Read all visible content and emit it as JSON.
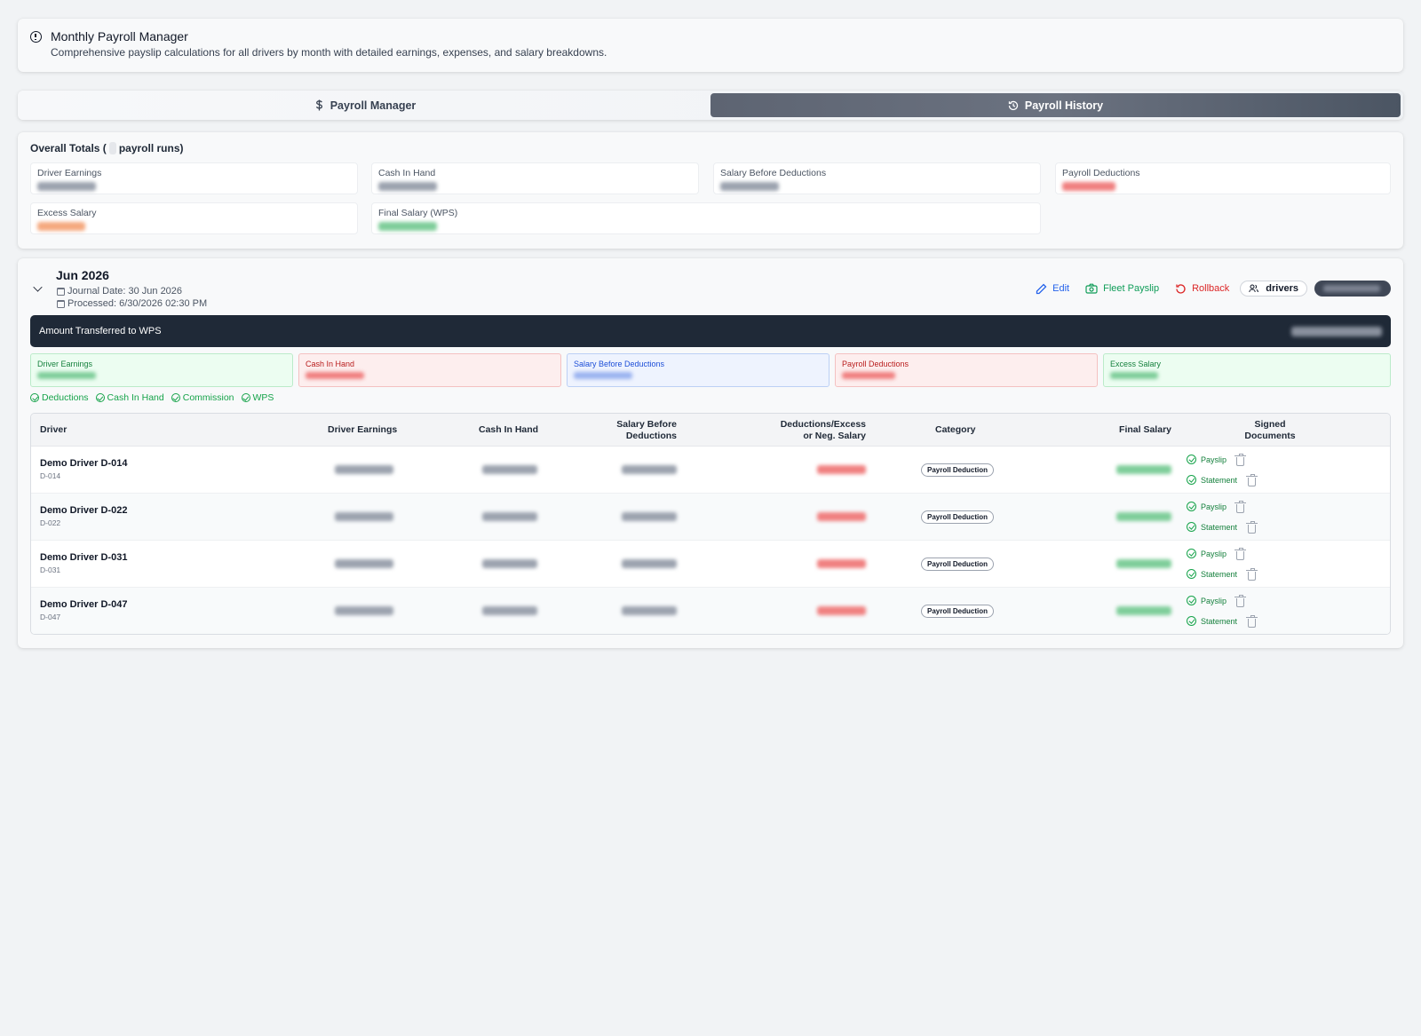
{
  "header": {
    "title": "Monthly Payroll Manager",
    "description": "Comprehensive payslip calculations for all drivers by month with detailed earnings, expenses, and salary breakdowns."
  },
  "tabs": [
    {
      "label": "Payroll Manager",
      "icon": "dollar-icon",
      "active": false
    },
    {
      "label": "Payroll History",
      "icon": "history-icon",
      "active": true
    }
  ],
  "overall": {
    "heading_prefix": "Overall Totals (",
    "heading_suffix": "payroll runs)",
    "stats": [
      {
        "label": "Driver Earnings"
      },
      {
        "label": "Cash In Hand"
      },
      {
        "label": "Salary Before Deductions"
      },
      {
        "label": "Payroll Deductions"
      },
      {
        "label": "Excess Salary"
      },
      {
        "label": "Final Salary (WPS)"
      }
    ]
  },
  "run": {
    "month": "Jun 2026",
    "journal_date": "Journal Date: 30 Jun 2026",
    "processed": "Processed: 6/30/2026 02:30 PM",
    "actions": {
      "edit": "Edit",
      "fleet_payslip": "Fleet Payslip",
      "rollback": "Rollback",
      "drivers": "drivers"
    },
    "wps_label": "Amount Transferred to WPS",
    "metrics": [
      {
        "label": "Driver Earnings"
      },
      {
        "label": "Cash In Hand"
      },
      {
        "label": "Salary Before Deductions"
      },
      {
        "label": "Payroll Deductions"
      },
      {
        "label": "Excess Salary"
      }
    ],
    "flags": [
      "Deductions",
      "Cash In Hand",
      "Commission",
      "WPS"
    ],
    "table": {
      "headers": {
        "driver": "Driver",
        "earnings": "Driver Earnings",
        "cash": "Cash In Hand",
        "salary_before_1": "Salary Before",
        "salary_before_2": "Deductions",
        "deductions_1": "Deductions/Excess",
        "deductions_2": "or Neg. Salary",
        "category": "Category",
        "final": "Final Salary",
        "signed_1": "Signed",
        "signed_2": "Documents"
      },
      "rows": [
        {
          "name": "Demo Driver D-014",
          "code": "D-014",
          "category": "Payroll Deduction",
          "payslip": "Payslip",
          "statement": "Statement"
        },
        {
          "name": "Demo Driver D-022",
          "code": "D-022",
          "category": "Payroll Deduction",
          "payslip": "Payslip",
          "statement": "Statement"
        },
        {
          "name": "Demo Driver D-031",
          "code": "D-031",
          "category": "Payroll Deduction",
          "payslip": "Payslip",
          "statement": "Statement"
        },
        {
          "name": "Demo Driver D-047",
          "code": "D-047",
          "category": "Payroll Deduction",
          "payslip": "Payslip",
          "statement": "Statement"
        }
      ]
    }
  },
  "colors": {
    "dark_banner": "#1f2937",
    "success": "#16a34a",
    "danger": "#dc2626",
    "link": "#2563eb"
  }
}
